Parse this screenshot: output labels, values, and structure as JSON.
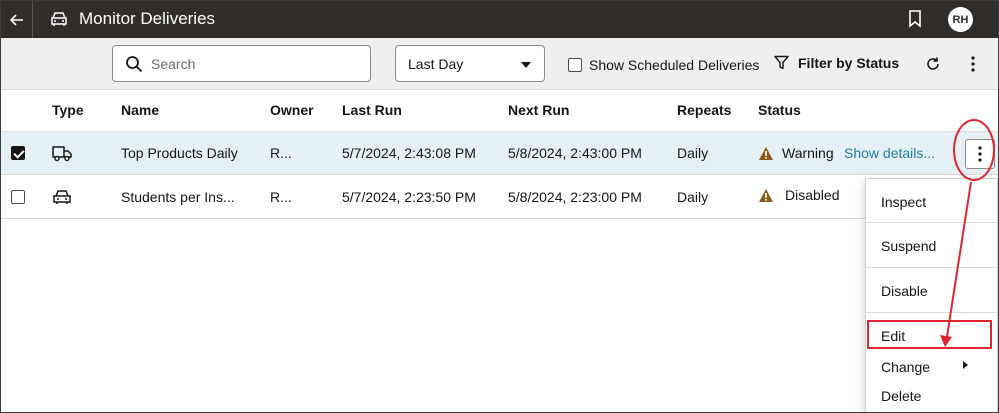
{
  "titlebar": {
    "title": "Monitor Deliveries",
    "avatar_initials": "RH",
    "back_icon": "arrow-left-icon",
    "title_icon": "car-icon",
    "bookmark_icon": "bookmark-icon"
  },
  "toolbar": {
    "search_placeholder": "Search",
    "search_value": "",
    "period_value": "Last Day",
    "show_scheduled_label": "Show Scheduled Deliveries",
    "show_scheduled_checked": false,
    "filter_label": "Filter by Status"
  },
  "table": {
    "headers": [
      "Type",
      "Name",
      "Owner",
      "Last Run",
      "Next Run",
      "Repeats",
      "Status"
    ],
    "rows": [
      {
        "selected": true,
        "type_icon": "truck-icon",
        "name": "Top Products Daily",
        "owner": "R...",
        "last_run": "5/7/2024, 2:43:08 PM",
        "next_run": "5/8/2024, 2:43:00 PM",
        "repeats": "Daily",
        "status": "Warning",
        "details_link": "Show details..."
      },
      {
        "selected": false,
        "type_icon": "car-icon",
        "name": "Students per Ins...",
        "owner": "R...",
        "last_run": "5/7/2024, 2:23:50 PM",
        "next_run": "5/8/2024, 2:23:00 PM",
        "repeats": "Daily",
        "status": "Disabled"
      }
    ]
  },
  "menu": {
    "items": [
      "Inspect",
      "Suspend",
      "Disable",
      "Edit",
      "Change",
      "Delete"
    ],
    "highlighted": "Edit"
  },
  "colors": {
    "titlebar_bg": "#312d2a",
    "toolbar_bg": "#f1efed",
    "selected_row_bg": "#e4f0f5",
    "link": "#227e9e",
    "warning": "#8a5a1c",
    "annotation_red": "#e1252e"
  }
}
